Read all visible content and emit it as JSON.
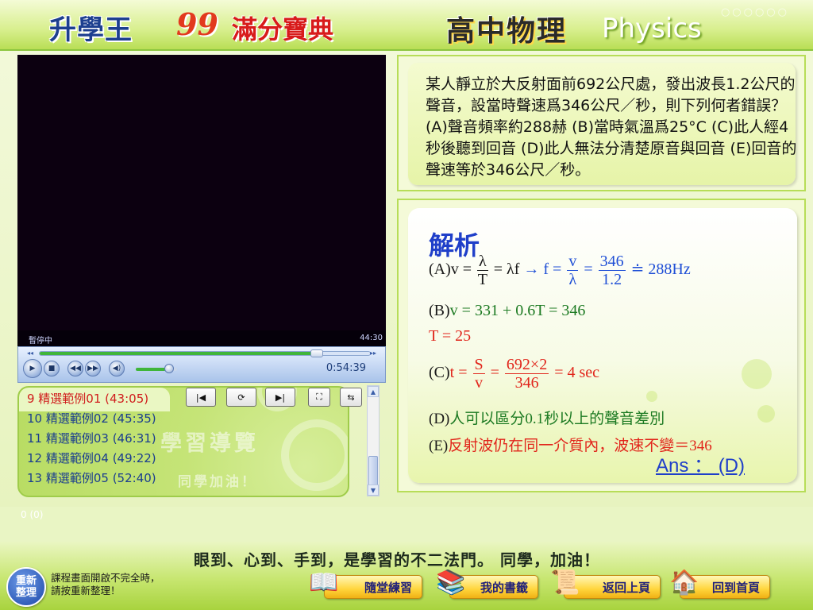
{
  "header": {
    "brand": "升學王",
    "brand_99": "99",
    "brand_sub": "滿分寶典",
    "subject_cn": "高中物理",
    "subject_en": "Physics"
  },
  "player": {
    "status_left": "暫停中",
    "status_right": "44:30",
    "time": "0:54:39",
    "seek_progress": 0.84,
    "volume_level": 0.7
  },
  "playlist": {
    "items": [
      {
        "label": "9 精選範例01 (43:05)",
        "active": true
      },
      {
        "label": "10 精選範例02 (45:35)",
        "active": false
      },
      {
        "label": "11 精選範例03 (46:31)",
        "active": false
      },
      {
        "label": "12 精選範例04 (49:22)",
        "active": false
      },
      {
        "label": "13 精選範例05 (52:40)",
        "active": false
      }
    ],
    "watermark": "學習導覽",
    "watermark2": "同學加油！"
  },
  "question": {
    "text": "某人靜立於大反射面前692公尺處，發出波長1.2公尺的聲音，設當時聲速爲346公尺／秒，則下列何者錯誤？(A)聲音頻率約288赫 (B)當時氣溫爲25°C (C)此人經4秒後聽到回音 (D)此人無法分清楚原音與回音 (E)回音的聲速等於346公尺／秒。"
  },
  "answer": {
    "title": "解析",
    "a_label": "(A)",
    "a_v": "v =",
    "a_frac1_n": "λ",
    "a_frac1_d": "T",
    "a_mid": "= λf",
    "a_arrow": "→ f =",
    "a_frac2_n": "v",
    "a_frac2_d": "λ",
    "a_eq": "=",
    "a_frac3_n": "346",
    "a_frac3_d": "1.2",
    "a_result": "≐ 288Hz",
    "b_label": "(B)",
    "b_eq": "v = 331 + 0.6T = 346",
    "b_t": "T = 25",
    "c_label": "(C)",
    "c_t": "t =",
    "c_frac1_n": "S",
    "c_frac1_d": "v",
    "c_eq": "=",
    "c_frac2_n": "692×2",
    "c_frac2_d": "346",
    "c_result": "= 4 sec",
    "d_label": "(D)",
    "d_text": "人可以區分0.1秒以上的聲音差別",
    "e_label": "(E)",
    "e_text": "反射波仍在同一介質內，波速不變＝346",
    "ans": "Ans ： (D)"
  },
  "status_bar": {
    "text": "0 (0)"
  },
  "footer": {
    "slogan": "眼到、心到、手到，是學習的不二法門。 同學，加油！",
    "refresh_label_1": "重新",
    "refresh_label_2": "整理",
    "refresh_note_1": "課程畫面開啟不完全時，",
    "refresh_note_2": "請按重新整理！",
    "btn_practice": "隨堂練習",
    "btn_bookmark": "我的書籤",
    "btn_back": "返回上頁",
    "btn_home": "回到首頁"
  }
}
